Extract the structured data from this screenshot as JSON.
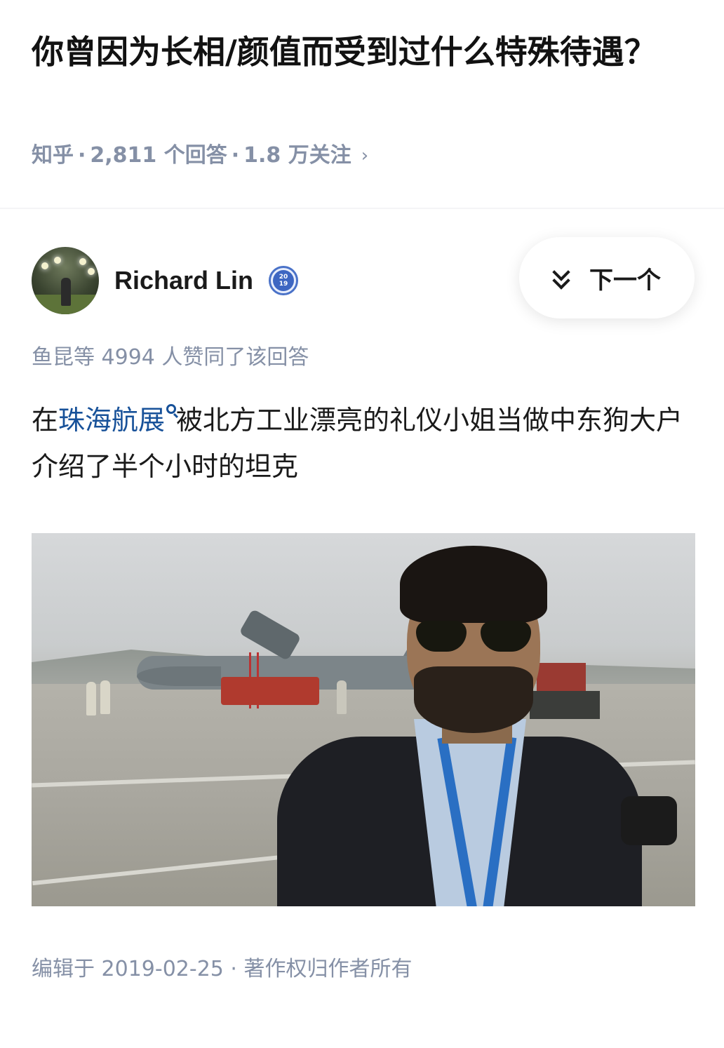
{
  "question": {
    "title": "你曾因为长相/颜值而受到过什么特殊待遇？",
    "source": "知乎",
    "dot": "·",
    "answers": "2,811 个回答",
    "followers": "1.8 万关注",
    "chevron_icon": "chevron-right-icon"
  },
  "author": {
    "name": "Richard Lin",
    "badge_top": "20",
    "badge_bottom": "19"
  },
  "next_button": {
    "label": "下一个",
    "icon": "double-chevron-down-icon"
  },
  "votes": "鱼昆等 4994 人赞同了该回答",
  "answer": {
    "prefix": "在",
    "link": "珠海航展",
    "rest": "被北方工业漂亮的礼仪小姐当做中东狗大户介绍了半个小时的坦克"
  },
  "footer": {
    "edited": "编辑于 2019-02-25 · 著作权归作者所有"
  },
  "colors": {
    "link": "#175199",
    "meta_gray": "#8590a6",
    "text": "#1a1a1a"
  }
}
